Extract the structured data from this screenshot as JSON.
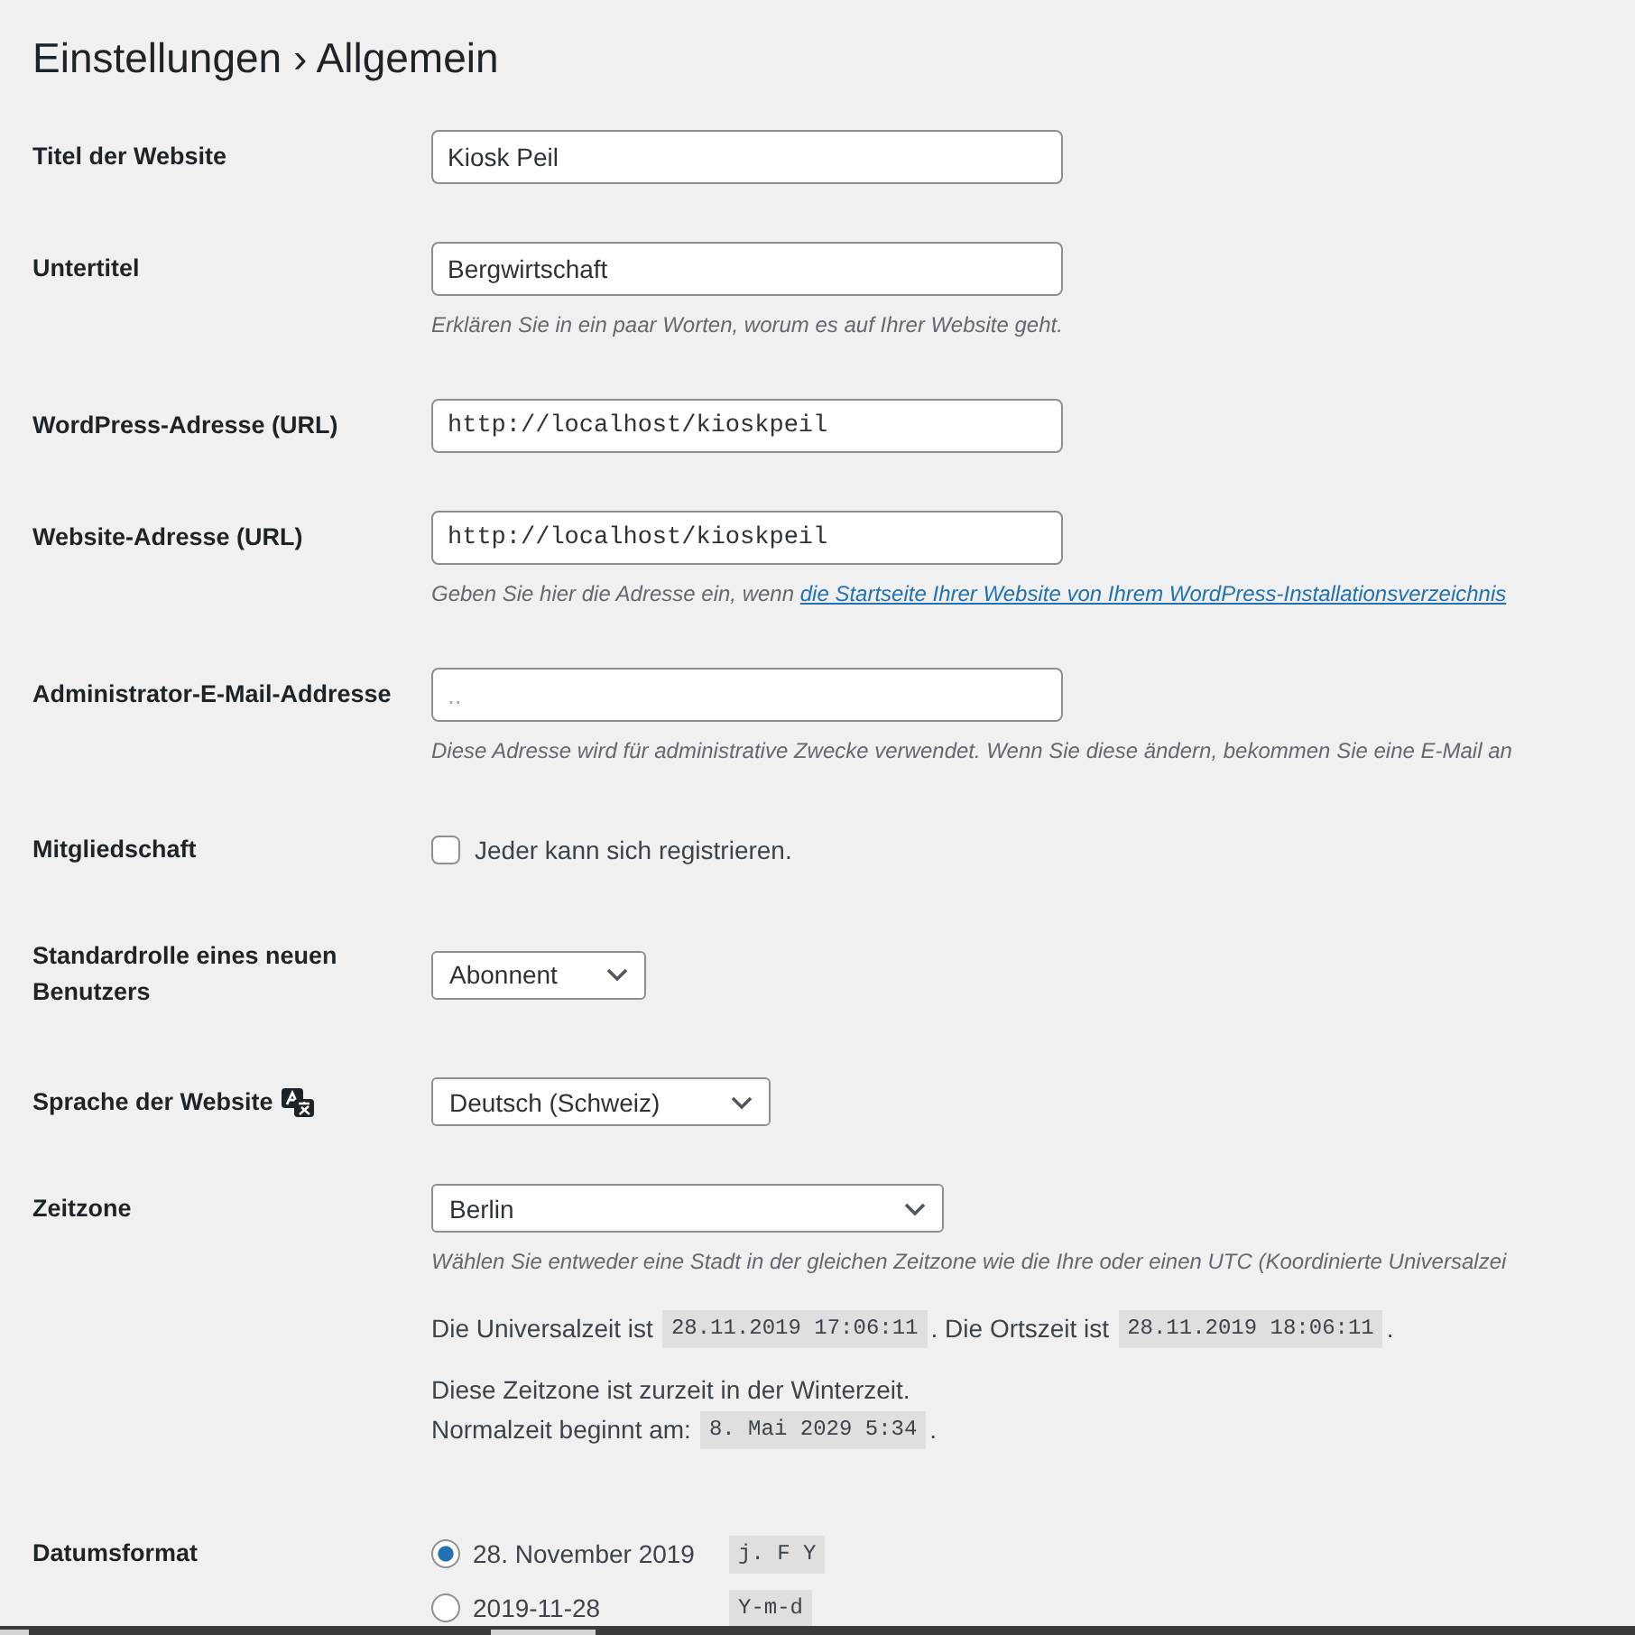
{
  "page_title": "Einstellungen › Allgemein",
  "fields": [
    {
      "kind": "text",
      "label": "Titel der Website",
      "value": "Kiosk Peil"
    },
    {
      "kind": "text",
      "label": "Untertitel",
      "value": "Bergwirtschaft",
      "description": "Erklären Sie in ein paar Worten, worum es auf Ihrer Website geht."
    },
    {
      "kind": "url",
      "label": "WordPress-Adresse (URL)",
      "value": "http://localhost/kioskpeil"
    },
    {
      "kind": "url",
      "label": "Website-Adresse (URL)",
      "value": "http://localhost/kioskpeil",
      "description": "Geben Sie hier die Adresse ein, wenn",
      "description_link": "die Startseite Ihrer Website von Ihrem WordPress-Installationsverzeichnis"
    },
    {
      "kind": "email",
      "label": "Administrator-E-Mail-Addresse",
      "value": "..",
      "description": "Diese Adresse wird für administrative Zwecke verwendet. Wenn Sie diese ändern, bekommen Sie eine E-Mail an"
    },
    {
      "kind": "checkbox",
      "label": "Mitgliedschaft",
      "option": "Jeder kann sich registrieren.",
      "checked": false
    },
    {
      "kind": "select",
      "label": "Standardrolle eines neuen Benutzers",
      "value": "Abonnent"
    },
    {
      "kind": "language",
      "label": "Sprache der Website",
      "value": "Deutsch (Schweiz)"
    },
    {
      "kind": "timezone",
      "label": "Zeitzone",
      "value": "Berlin",
      "description": "Wählen Sie entweder eine Stadt in der gleichen Zeitzone wie die Ihre oder einen UTC (Koordinierte Universalzei",
      "notes": [
        {
          "lines": [
            [
              {
                "kind": "text",
                "text": "Die Universalzeit ist"
              },
              {
                "kind": "code",
                "text": "28.11.2019 17:06:11"
              },
              {
                "kind": "text",
                "text": ". Die Ortszeit ist"
              },
              {
                "kind": "code",
                "text": "28.11.2019 18:06:11"
              },
              {
                "kind": "text",
                "text": "."
              }
            ]
          ]
        },
        {
          "lines": [
            [
              {
                "kind": "text",
                "text": "Diese Zeitzone ist zurzeit in der Winterzeit."
              }
            ],
            [
              {
                "kind": "text",
                "text": "Normalzeit beginnt am:"
              },
              {
                "kind": "code",
                "text": "8. Mai 2029 5:34"
              },
              {
                "kind": "text",
                "text": "."
              }
            ]
          ]
        }
      ]
    },
    {
      "kind": "radio",
      "label": "Datumsformat",
      "options": [
        {
          "label": "28. November 2019",
          "format": "j. F Y",
          "selected": true
        },
        {
          "label": "2019-11-28",
          "format": "Y-m-d",
          "selected": false
        }
      ]
    }
  ]
}
